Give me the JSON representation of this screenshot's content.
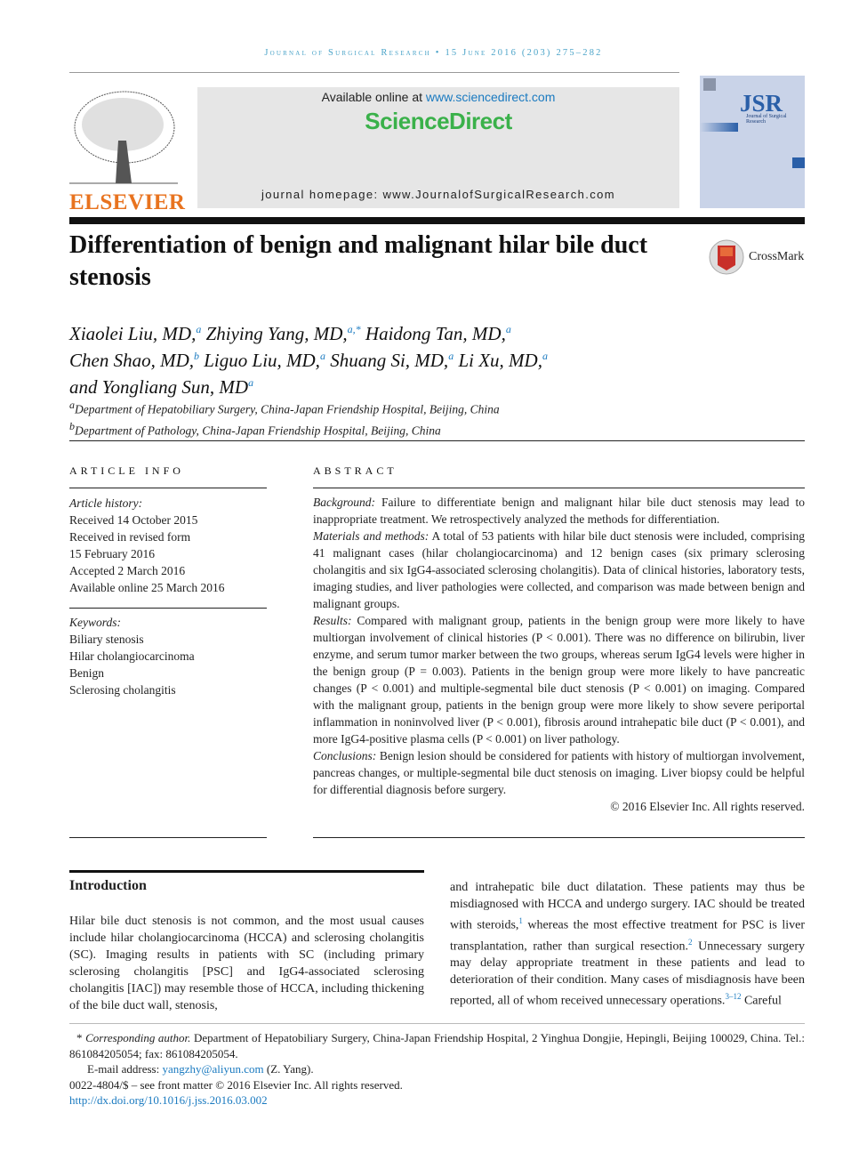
{
  "running_header": "Journal of Surgical Research • 15 June 2016 (203) 275–282",
  "publisher_logo": "ELSEVIER",
  "banner": {
    "available_prefix": "Available online at ",
    "available_link": "www.sciencedirect.com",
    "brand": "ScienceDirect",
    "homepage": "journal homepage: www.JournalofSurgicalResearch.com"
  },
  "cover": {
    "logo": "JSR",
    "subtitle": "Journal of Surgical Research"
  },
  "crossmark": "CrossMark",
  "title": "Differentiation of benign and malignant hilar bile duct stenosis",
  "authors": [
    {
      "name": "Xiaolei Liu, MD,",
      "aff": "a"
    },
    {
      "name": "Zhiying Yang, MD,",
      "aff": "a,*"
    },
    {
      "name": "Haidong Tan, MD,",
      "aff": "a"
    },
    {
      "name": "Chen Shao, MD,",
      "aff": "b"
    },
    {
      "name": "Liguo Liu, MD,",
      "aff": "a"
    },
    {
      "name": "Shuang Si, MD,",
      "aff": "a"
    },
    {
      "name": "Li Xu, MD,",
      "aff": "a"
    },
    {
      "name": "and Yongliang Sun, MD",
      "aff": "a"
    }
  ],
  "affiliations": [
    {
      "mark": "a",
      "text": "Department of Hepatobiliary Surgery, China-Japan Friendship Hospital, Beijing, China"
    },
    {
      "mark": "b",
      "text": "Department of Pathology, China-Japan Friendship Hospital, Beijing, China"
    }
  ],
  "article_info": {
    "heading": "ARTICLE INFO",
    "history_label": "Article history:",
    "history": [
      "Received 14 October 2015",
      "Received in revised form",
      "15 February 2016",
      "Accepted 2 March 2016",
      "Available online 25 March 2016"
    ],
    "keywords_label": "Keywords:",
    "keywords": [
      "Biliary stenosis",
      "Hilar cholangiocarcinoma",
      "Benign",
      "Sclerosing cholangitis"
    ]
  },
  "abstract": {
    "heading": "ABSTRACT",
    "sections": [
      {
        "label": "Background:",
        "text": " Failure to differentiate benign and malignant hilar bile duct stenosis may lead to inappropriate treatment. We retrospectively analyzed the methods for differentiation."
      },
      {
        "label": "Materials and methods:",
        "text": " A total of 53 patients with hilar bile duct stenosis were included, comprising 41 malignant cases (hilar cholangiocarcinoma) and 12 benign cases (six primary sclerosing cholangitis and six IgG4-associated sclerosing cholangitis). Data of clinical histories, laboratory tests, imaging studies, and liver pathologies were collected, and comparison was made between benign and malignant groups."
      },
      {
        "label": "Results:",
        "text": " Compared with malignant group, patients in the benign group were more likely to have multiorgan involvement of clinical histories (P < 0.001). There was no difference on bilirubin, liver enzyme, and serum tumor marker between the two groups, whereas serum IgG4 levels were higher in the benign group (P = 0.003). Patients in the benign group were more likely to have pancreatic changes (P < 0.001) and multiple-segmental bile duct stenosis (P < 0.001) on imaging. Compared with the malignant group, patients in the benign group were more likely to show severe periportal inflammation in noninvolved liver (P < 0.001), fibrosis around intrahepatic bile duct (P < 0.001), and more IgG4-positive plasma cells (P < 0.001) on liver pathology."
      },
      {
        "label": "Conclusions:",
        "text": " Benign lesion should be considered for patients with history of multiorgan involvement, pancreas changes, or multiple-segmental bile duct stenosis on imaging. Liver biopsy could be helpful for differential diagnosis before surgery."
      }
    ],
    "copyright": "© 2016 Elsevier Inc. All rights reserved."
  },
  "introduction": {
    "heading": "Introduction",
    "left": "Hilar bile duct stenosis is not common, and the most usual causes include hilar cholangiocarcinoma (HCCA) and sclerosing cholangitis (SC). Imaging results in patients with SC (including primary sclerosing cholangitis [PSC] and IgG4-associated sclerosing cholangitis [IAC]) may resemble those of HCCA, including thickening of the bile duct wall, stenosis,",
    "right_1": "and intrahepatic bile duct dilatation. These patients may thus be misdiagnosed with HCCA and undergo surgery. IAC should be treated with steroids,",
    "ref_1": "1",
    "right_2": " whereas the most effective treatment for PSC is liver transplantation, rather than surgical resection.",
    "ref_2": "2",
    "right_3": " Unnecessary surgery may delay appropriate treatment in these patients and lead to deterioration of their condition. Many cases of misdiagnosis have been reported, all of whom received unnecessary operations.",
    "ref_3": "3–12",
    "right_4": " Careful"
  },
  "footnotes": {
    "corresponding_label": "Corresponding author.",
    "corresponding_text": " Department of Hepatobiliary Surgery, China-Japan Friendship Hospital, 2 Yinghua Dongjie, Hepingli, Beijing 100029, China. Tel.: 861084205054; fax: 861084205054.",
    "email_label": "E-mail address: ",
    "email": "yangzhy@aliyun.com",
    "email_suffix": " (Z. Yang).",
    "issn": "0022-4804/$ – see front matter © 2016 Elsevier Inc. All rights reserved.",
    "doi": "http://dx.doi.org/10.1016/j.jss.2016.03.002"
  },
  "colors": {
    "accent": "#1a7ac0",
    "sciencedirect": "#3ab14a",
    "elsevier": "#e8731f",
    "header": "#4aa3c8"
  }
}
